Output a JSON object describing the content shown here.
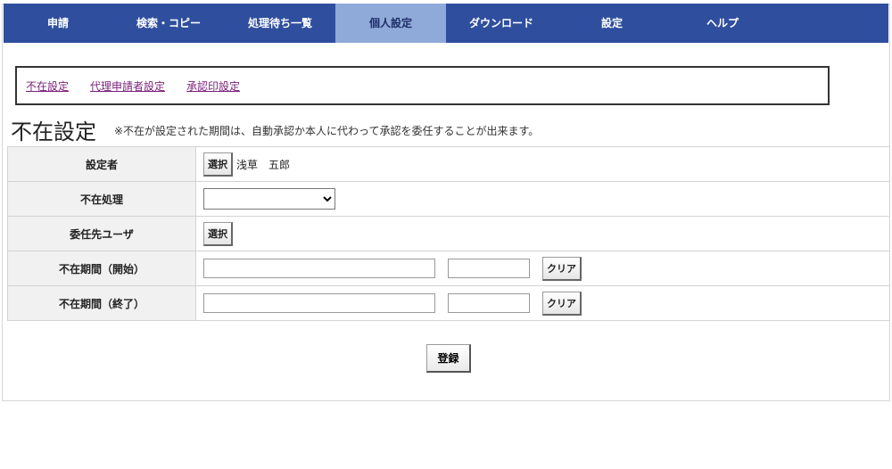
{
  "nav": {
    "items": [
      {
        "label": "申請"
      },
      {
        "label": "検索・コピー"
      },
      {
        "label": "処理待ち一覧"
      },
      {
        "label": "個人設定"
      },
      {
        "label": "ダウンロード"
      },
      {
        "label": "設定"
      },
      {
        "label": "ヘルプ"
      }
    ],
    "active_index": 3,
    "color": "#2f4f9e",
    "active_color": "#8faad8"
  },
  "subnav": {
    "links": [
      "不在設定",
      "代理申請者設定",
      "承認印設定"
    ]
  },
  "page": {
    "title": "不在設定",
    "note": "※不在が設定された期間は、自動承認か本人に代わって承認を委任することが出来ます。"
  },
  "form": {
    "setter_label": "設定者",
    "setter_button": "選択",
    "setter_name": "浅草　五郎",
    "absence_label": "不在処理",
    "absence_value": "",
    "delegate_label": "委任先ユーザ",
    "delegate_button": "選択",
    "start_label": "不在期間（開始）",
    "start_date": "",
    "start_time": "",
    "start_clear": "クリア",
    "end_label": "不在期間（終了）",
    "end_date": "",
    "end_time": "",
    "end_clear": "クリア"
  },
  "register_button": "登録"
}
